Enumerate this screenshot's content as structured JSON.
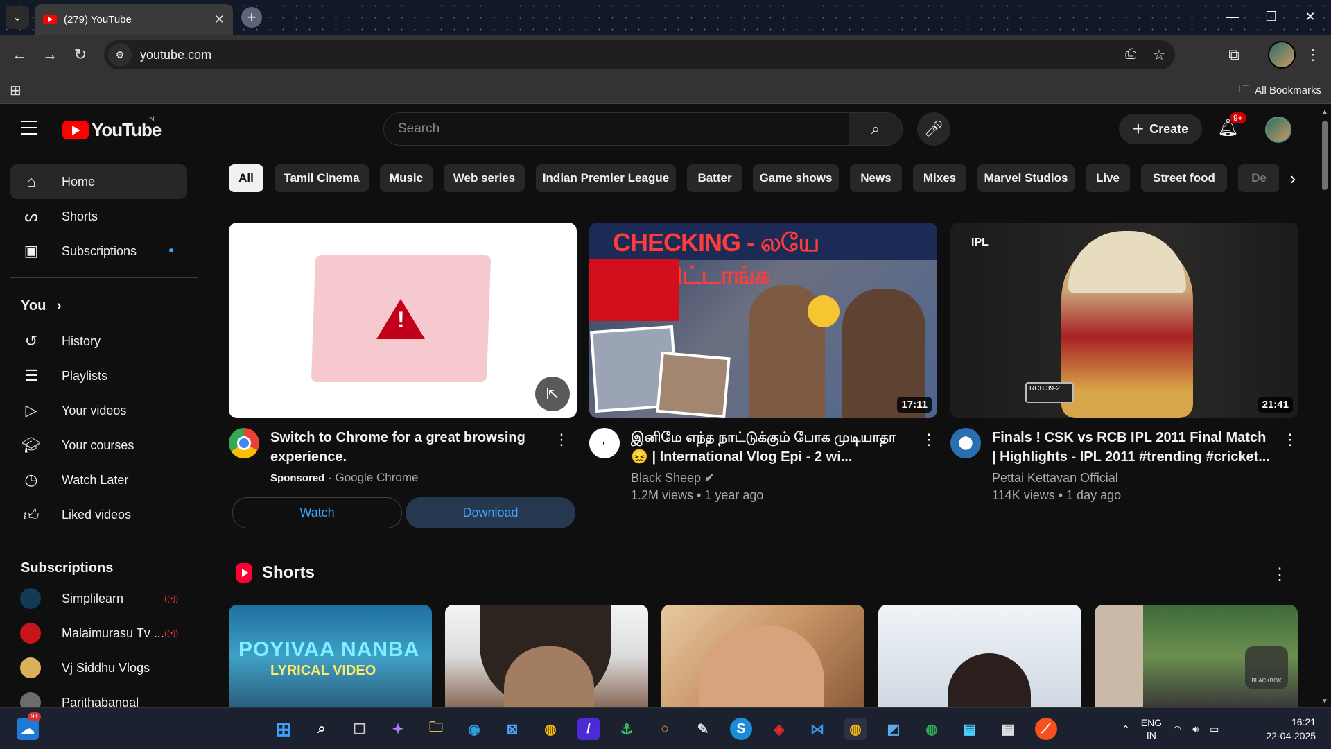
{
  "browser": {
    "tab_title": "(279) YouTube",
    "url": "youtube.com",
    "bookmarks_label": "All Bookmarks"
  },
  "youtube": {
    "logo_text": "YouTube",
    "country_code": "IN",
    "search_placeholder": "Search",
    "create_label": "Create",
    "notification_badge": "9+"
  },
  "sidebar": {
    "main": [
      {
        "label": "Home",
        "icon": "home-icon",
        "active": true
      },
      {
        "label": "Shorts",
        "icon": "shorts-icon"
      },
      {
        "label": "Subscriptions",
        "icon": "subscriptions-icon"
      }
    ],
    "you_heading": "You",
    "you_items": [
      {
        "label": "History",
        "icon": "history-icon"
      },
      {
        "label": "Playlists",
        "icon": "playlists-icon"
      },
      {
        "label": "Your videos",
        "icon": "your-videos-icon"
      },
      {
        "label": "Your courses",
        "icon": "courses-icon"
      },
      {
        "label": "Watch Later",
        "icon": "watch-later-icon"
      },
      {
        "label": "Liked videos",
        "icon": "liked-icon"
      }
    ],
    "subscriptions_heading": "Subscriptions",
    "subscriptions": [
      {
        "label": "Simplilearn",
        "live": true
      },
      {
        "label": "Malaimurasu Tv ...",
        "live": true
      },
      {
        "label": "Vj Siddhu Vlogs",
        "live": false
      },
      {
        "label": "Parithabangal",
        "live": false
      }
    ]
  },
  "chips": [
    "All",
    "Tamil Cinema",
    "Music",
    "Web series",
    "Indian Premier League",
    "Batter",
    "Game shows",
    "News",
    "Mixes",
    "Marvel Studios",
    "Live",
    "Street food",
    "De"
  ],
  "ad": {
    "title": "Switch to Chrome for a great browsing experience.",
    "sponsored": "Sponsored",
    "advertiser": "Google Chrome",
    "watch_label": "Watch",
    "download_label": "Download"
  },
  "videos": [
    {
      "title": "இனிமே எந்த நாட்டுக்கும் போக முடியாதா 😖 | International Vlog Epi - 2 wi...",
      "channel": "Black Sheep",
      "verified": true,
      "views": "1.2M views",
      "age": "1 year ago",
      "duration": "17:11",
      "thumb_headline": "CHECKING - லயே புடிச்சிட்டாங்க"
    },
    {
      "title": "Finals ! CSK vs RCB IPL 2011 Final Match | Highlights - IPL 2011 #trending #cricket...",
      "channel": "Pettai Kettavan Official",
      "verified": false,
      "views": "114K views",
      "age": "1 day ago",
      "duration": "21:41",
      "thumb_logo": "IPL",
      "thumb_score": "RCB 39-2"
    }
  ],
  "shorts": {
    "heading": "Shorts",
    "items": [
      {
        "overlay": "POYIVAA NANBA",
        "overlay2": "LYRICAL VIDEO"
      },
      {
        "overlay": ""
      },
      {
        "overlay": ""
      },
      {
        "overlay": ""
      },
      {
        "overlay": "BLACKBOX"
      }
    ]
  },
  "taskbar": {
    "lang_line1": "ENG",
    "lang_line2": "IN",
    "time": "16:21",
    "date": "22-04-2025",
    "widget_badge": "9+"
  },
  "colors": {
    "youtube_red": "#ff0000",
    "link_blue": "#3ea6ff",
    "bg": "#0f0f0f",
    "chip_bg": "#272727"
  }
}
